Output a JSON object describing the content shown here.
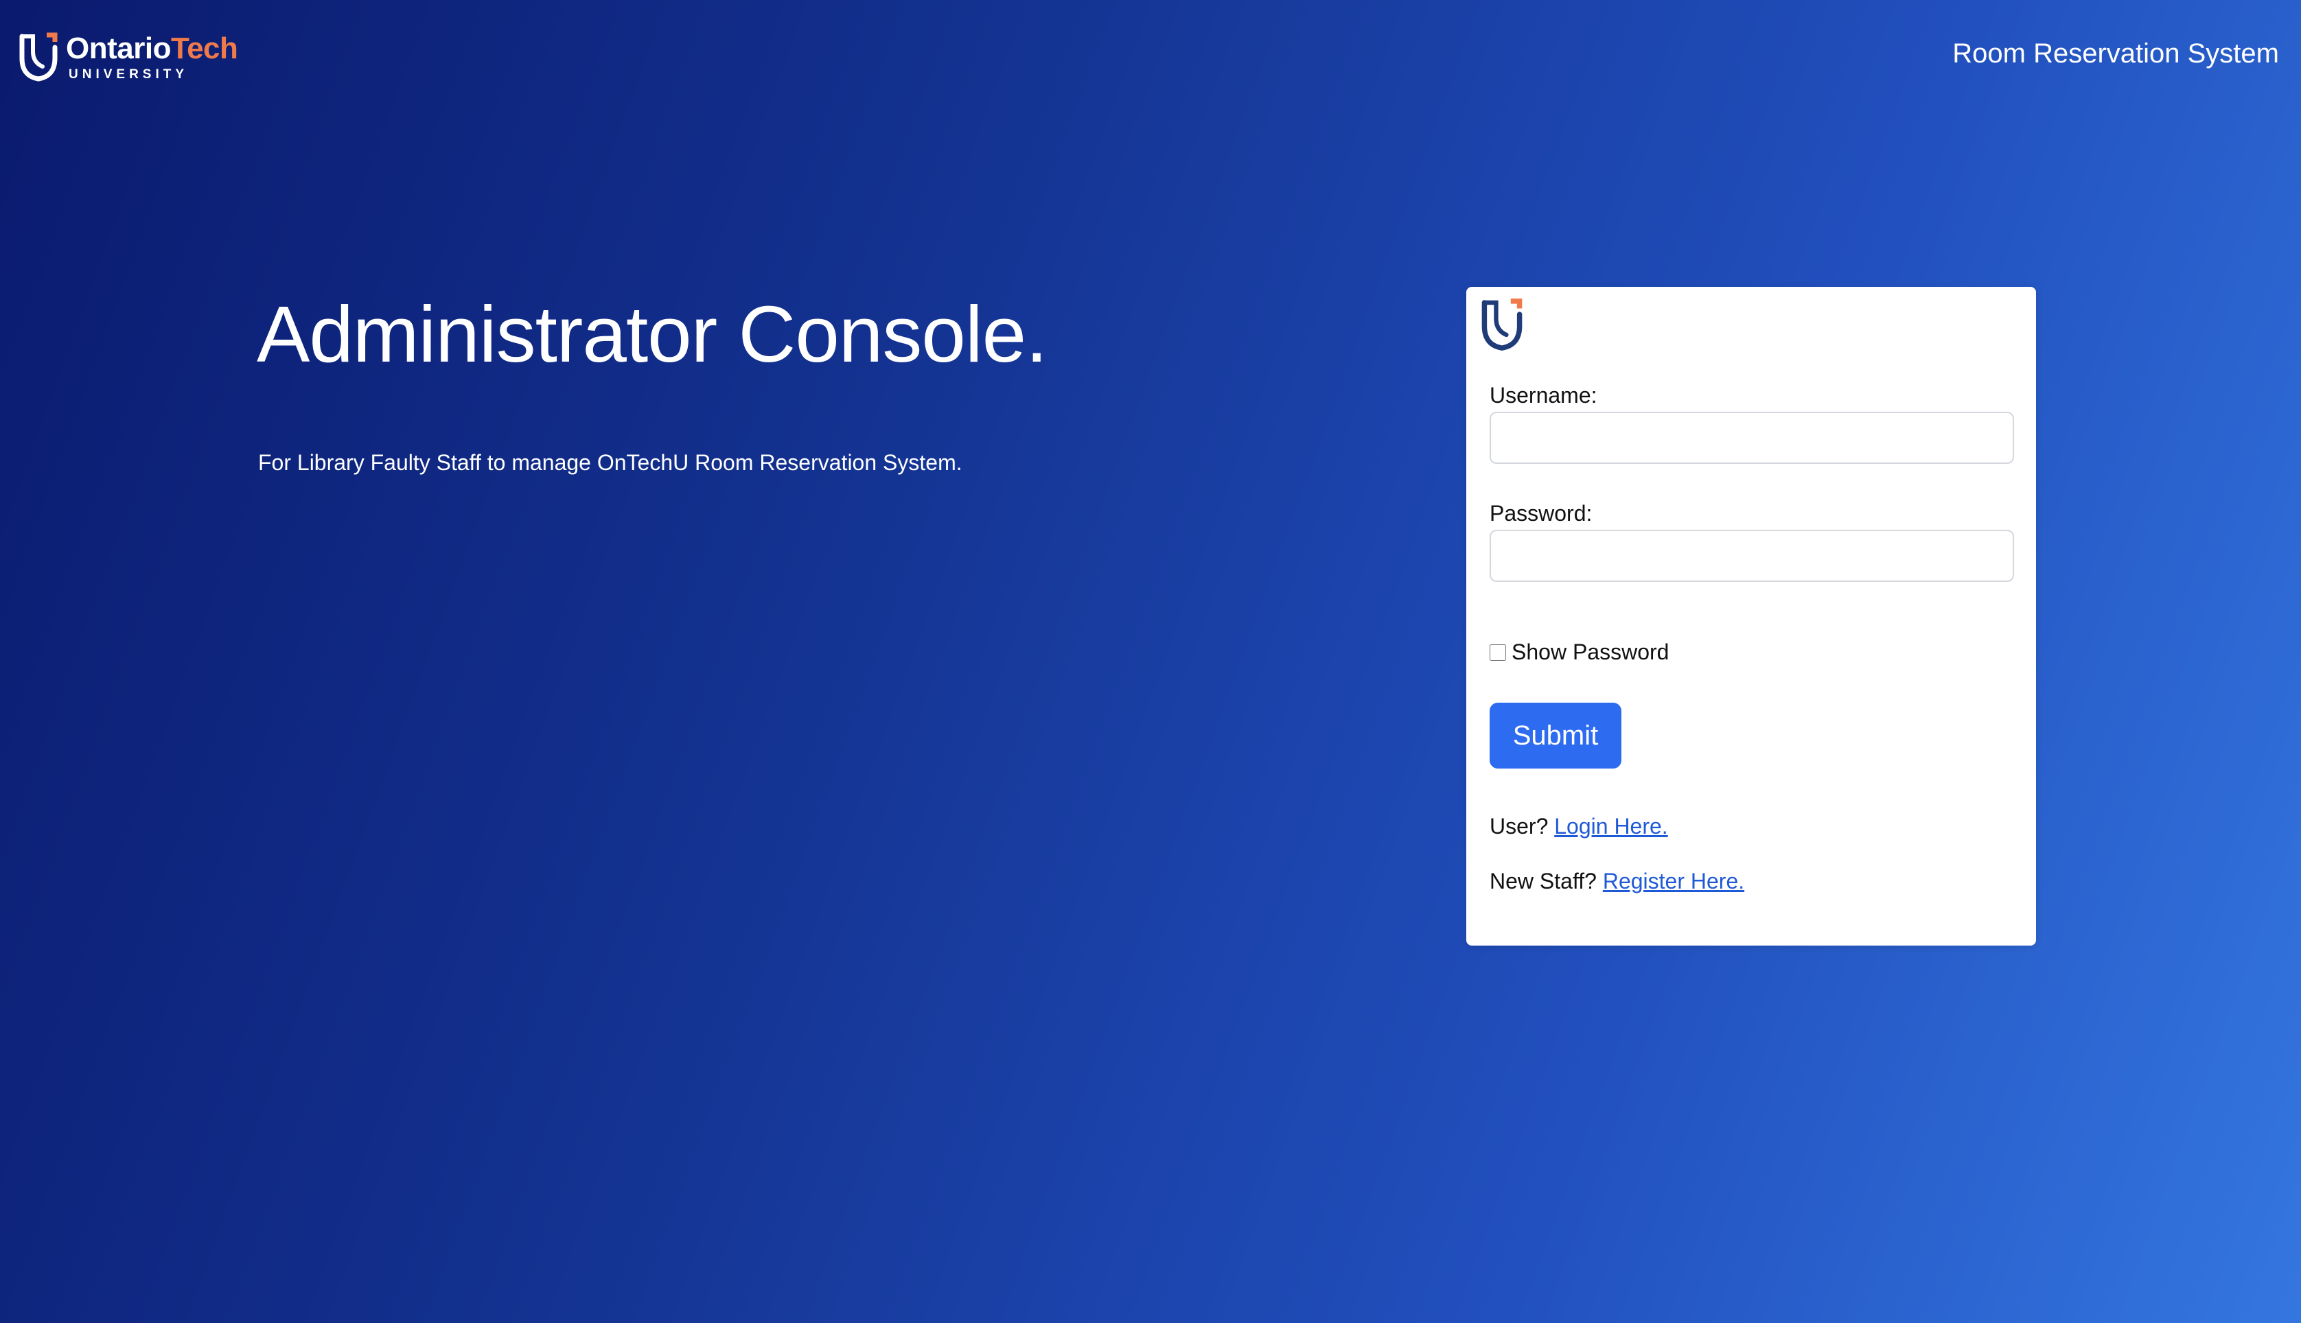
{
  "header": {
    "brand_word_primary": "Ontario",
    "brand_word_accent": "Tech",
    "brand_sub": "UNIVERSITY",
    "nav_title": "Room Reservation System",
    "logo_icon": "ontario-tech-shield-icon"
  },
  "hero": {
    "title": "Administrator Console.",
    "description": "For Library Faulty Staff to manage OnTechU Room Reservation System."
  },
  "login_form": {
    "logo_icon": "ontario-tech-shield-icon",
    "username_label": "Username:",
    "username_value": "",
    "password_label": "Password:",
    "password_value": "",
    "show_password_label": "Show Password",
    "show_password_checked": false,
    "submit_label": "Submit",
    "user_prompt": "User?",
    "user_link": "Login Here.",
    "staff_prompt": "New Staff?",
    "staff_link": "Register Here."
  },
  "colors": {
    "accent_orange": "#f07a4a",
    "button_blue": "#2d6bf0",
    "link_blue": "#1f5ad6",
    "shield_navy": "#1f3b78"
  }
}
